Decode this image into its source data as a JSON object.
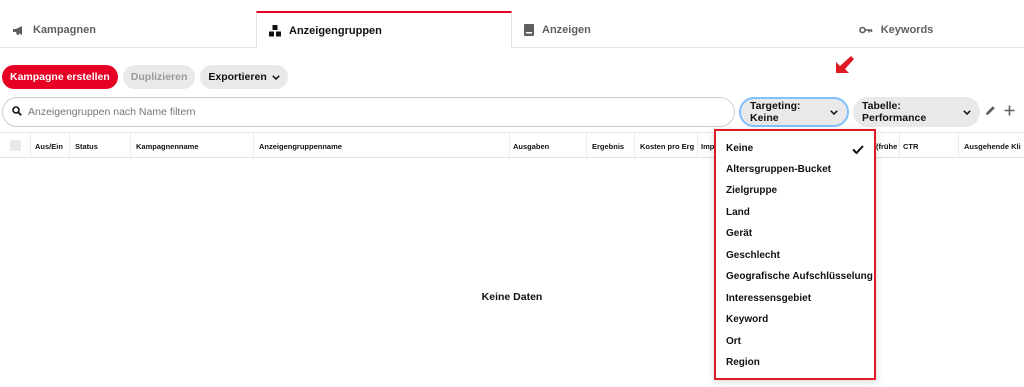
{
  "tabs": [
    {
      "label": "Kampagnen",
      "icon": "megaphone-icon"
    },
    {
      "label": "Anzeigengruppen",
      "icon": "adgroup-icon",
      "active": true
    },
    {
      "label": "Anzeigen",
      "icon": "ad-icon"
    },
    {
      "label": "Keywords",
      "icon": "key-icon"
    }
  ],
  "toolbar": {
    "create_label": "Kampagne erstellen",
    "duplicate_label": "Duplizieren",
    "export_label": "Exportieren"
  },
  "search": {
    "placeholder": "Anzeigengruppen nach Name filtern"
  },
  "filters": {
    "targeting_label": "Targeting: Keine",
    "table_label": "Tabelle: Performance"
  },
  "table": {
    "columns": [
      "Aus/Ein",
      "Status",
      "Kampagnenname",
      "Anzeigengruppenname",
      "Ausgaben",
      "Ergebnis",
      "Kosten pro Erge",
      "Imp",
      "(frühe",
      "CTR",
      "Ausgehende Kli"
    ],
    "empty_text": "Keine Daten"
  },
  "dropdown": {
    "items": [
      "Keine",
      "Altersgruppen-Bucket",
      "Zielgruppe",
      "Land",
      "Gerät",
      "Geschlecht",
      "Geografische Aufschlüsselung",
      "Interessensgebiet",
      "Keyword",
      "Ort",
      "Region"
    ],
    "selected": "Keine"
  },
  "colors": {
    "brand_red": "#e60023",
    "highlight_border": "#e01a24",
    "focus_ring": "#7fc1ff"
  }
}
